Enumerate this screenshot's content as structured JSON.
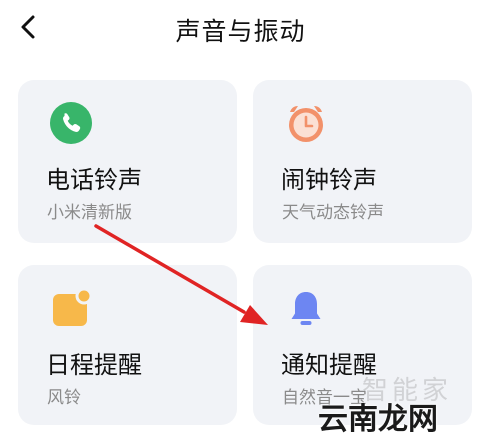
{
  "header": {
    "title": "声音与振动"
  },
  "cards": {
    "ringtone": {
      "title": "电话铃声",
      "subtitle": "小米清新版",
      "icon": "phone-icon",
      "color": "#38b56a"
    },
    "alarm": {
      "title": "闹钟铃声",
      "subtitle": "天气动态铃声",
      "icon": "alarm-clock-icon",
      "color": "#f2916a"
    },
    "calendar": {
      "title": "日程提醒",
      "subtitle": "风铃",
      "icon": "calendar-icon",
      "color": "#f7b84a"
    },
    "notification": {
      "title": "通知提醒",
      "subtitle": "自然音一宝",
      "icon": "bell-icon",
      "color": "#6d86f2"
    }
  },
  "overlay": {
    "arrow_color": "#e02424",
    "watermark_faint": "智能家",
    "watermark_strong": "云南龙网"
  }
}
